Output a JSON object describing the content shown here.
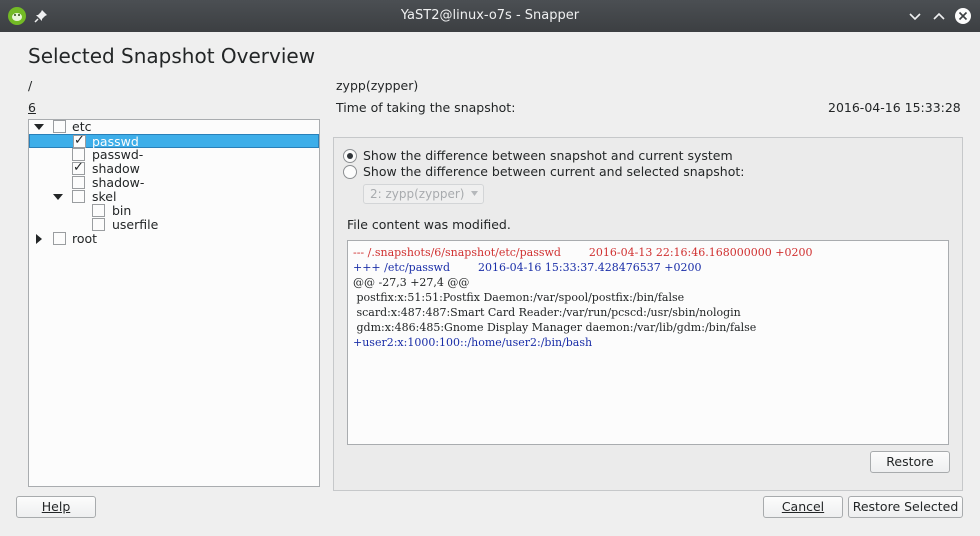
{
  "window": {
    "title": "YaST2@linux-o7s - Snapper"
  },
  "page": {
    "heading": "Selected Snapshot Overview",
    "path": "/",
    "snapshot_number": "6",
    "snapshot_description": "zypp(zypper)",
    "time_label": "Time of taking the snapshot:",
    "time_value": "2016-04-16 15:33:28"
  },
  "tree": [
    {
      "label": "etc",
      "checked": false,
      "expanded": true
    },
    {
      "label": "passwd",
      "checked": true,
      "selected": true
    },
    {
      "label": "passwd-",
      "checked": false
    },
    {
      "label": "shadow",
      "checked": true
    },
    {
      "label": "shadow-",
      "checked": false
    },
    {
      "label": "skel",
      "checked": false,
      "expanded": true
    },
    {
      "label": "bin",
      "checked": false
    },
    {
      "label": "userfile",
      "checked": false
    },
    {
      "label": "root",
      "checked": false,
      "expanded": false
    }
  ],
  "compare": {
    "option_current": "Show the difference between snapshot and current system",
    "option_selected": "Show the difference between current and selected snapshot:",
    "selected_option": "option_current",
    "snapshot_select_value": "2: zypp(zypper)"
  },
  "status": "File content was modified.",
  "diff_lines": [
    {
      "text": "--- /.snapshots/6/snapshot/etc/passwd        2016-04-13 22:16:46.168000000 +0200",
      "kind": "removed"
    },
    {
      "text": "+++ /etc/passwd        2016-04-16 15:33:37.428476537 +0200",
      "kind": "added"
    },
    {
      "text": "@@ -27,3 +27,4 @@",
      "kind": "context"
    },
    {
      "text": " postfix:x:51:51:Postfix Daemon:/var/spool/postfix:/bin/false",
      "kind": "context"
    },
    {
      "text": " scard:x:487:487:Smart Card Reader:/var/run/pcscd:/usr/sbin/nologin",
      "kind": "context"
    },
    {
      "text": " gdm:x:486:485:Gnome Display Manager daemon:/var/lib/gdm:/bin/false",
      "kind": "context"
    },
    {
      "text": "+user2:x:1000:100::/home/user2:/bin/bash",
      "kind": "added"
    }
  ],
  "buttons": {
    "restore": "Restore",
    "help": "Help",
    "cancel": "Cancel",
    "restore_selected": "Restore Selected"
  },
  "colors": {
    "selection": "#3daee9",
    "removed": "#d03131",
    "added": "#1a2ea8"
  }
}
